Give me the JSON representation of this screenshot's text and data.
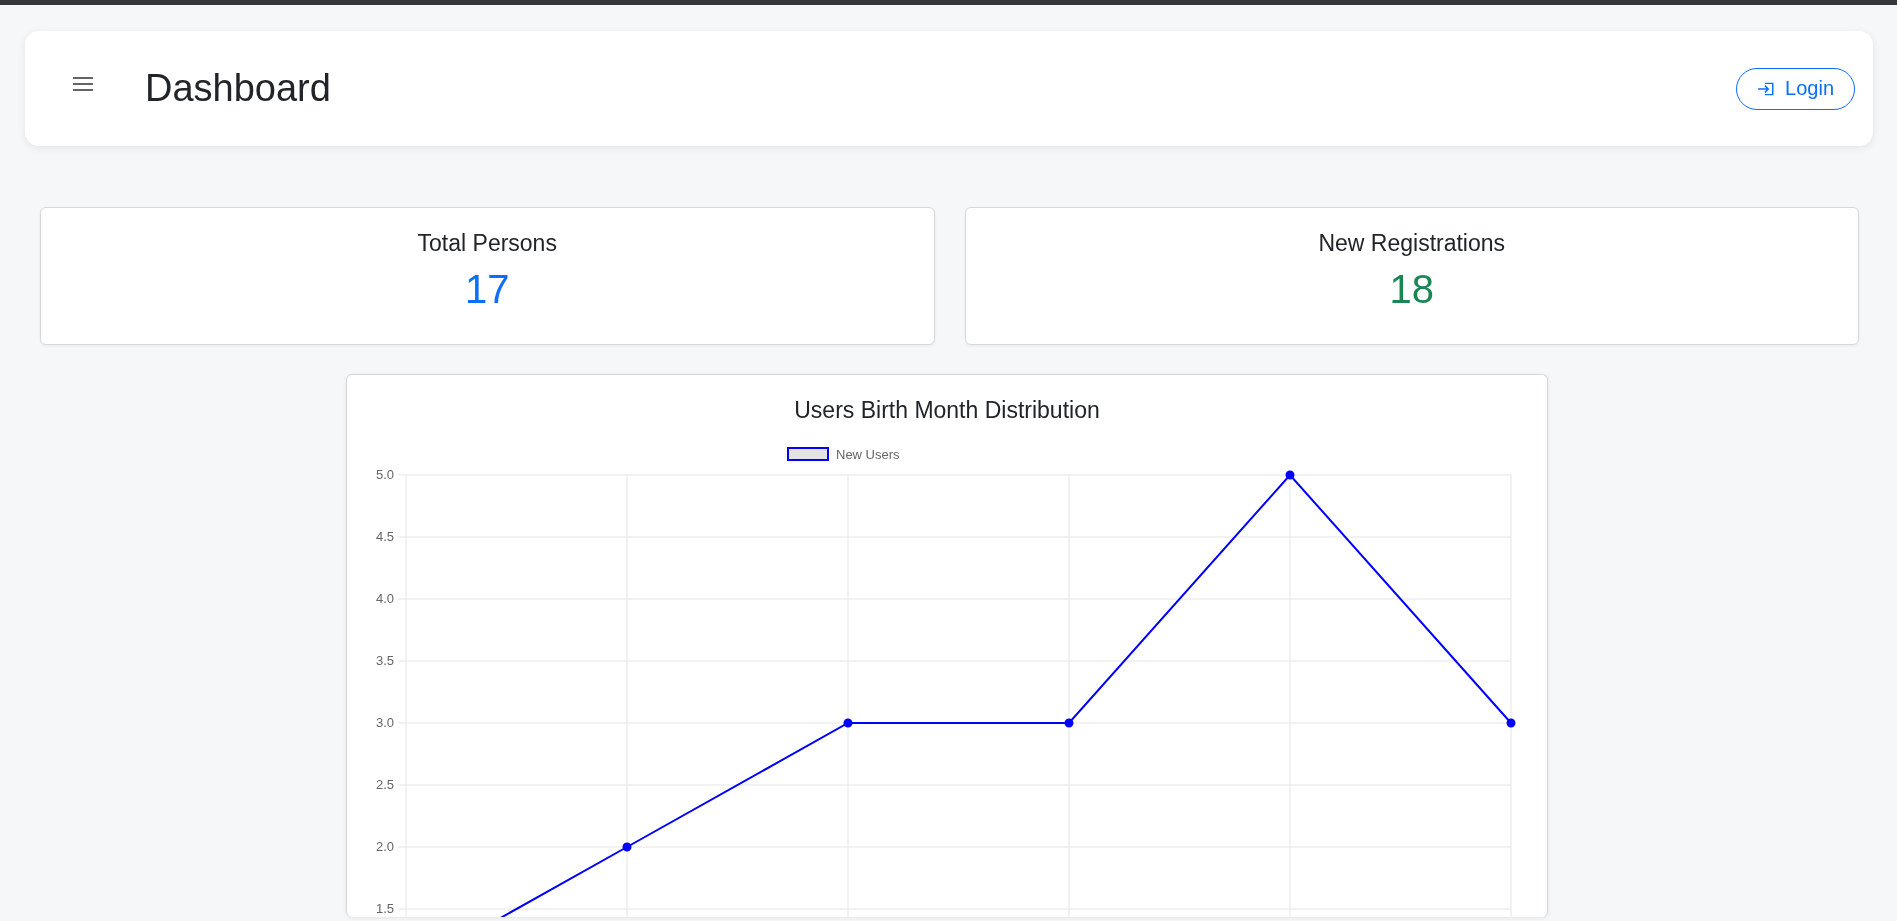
{
  "header": {
    "title": "Dashboard",
    "login_button": "Login"
  },
  "stats": [
    {
      "label": "Total Persons",
      "value": "17",
      "color": "#0d6efd"
    },
    {
      "label": "New Registrations",
      "value": "18",
      "color": "#198754"
    }
  ],
  "chart_card": {
    "chart_data": {
      "type": "line",
      "title": "Users Birth Month Distribution",
      "categories": [
        null,
        null,
        null,
        null,
        null,
        null
      ],
      "ylim": [
        1,
        5
      ],
      "grid": true,
      "series": [
        {
          "name": "New Users",
          "color": "#0000ff",
          "marker": "circle",
          "values": [
            1,
            2,
            3,
            3,
            5,
            3
          ]
        }
      ],
      "yticks": [
        {
          "value": 5,
          "label": "5.0"
        },
        {
          "value": 4.5,
          "label": "4.5"
        },
        {
          "value": 4,
          "label": "4.0"
        },
        {
          "value": 3.5,
          "label": "3.5"
        },
        {
          "value": 3,
          "label": "3.0"
        },
        {
          "value": 2.5,
          "label": "2.5"
        },
        {
          "value": 2,
          "label": "2.0"
        },
        {
          "value": 1.5,
          "label": "1.5"
        }
      ]
    }
  }
}
